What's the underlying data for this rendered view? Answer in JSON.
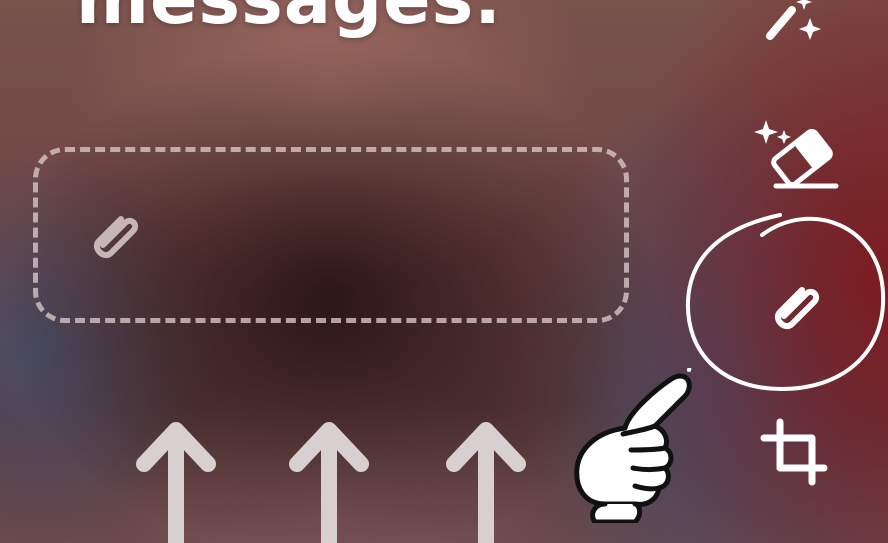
{
  "headline": {
    "text": "messages."
  },
  "toolbar": {
    "tools": [
      {
        "name": "magic-wand",
        "icon": "magic-wand-icon"
      },
      {
        "name": "magic-eraser",
        "icon": "sparkle-eraser-icon"
      },
      {
        "name": "attach",
        "icon": "paperclip-icon",
        "highlighted": true
      },
      {
        "name": "crop",
        "icon": "crop-icon"
      }
    ]
  },
  "drop_zone": {
    "icon": "paperclip-icon"
  },
  "annotations": {
    "arrows": 3,
    "pointer": "pointing-hand-icon"
  },
  "colors": {
    "foreground": "#ffffff",
    "dashed_border": "#dac8c8"
  }
}
